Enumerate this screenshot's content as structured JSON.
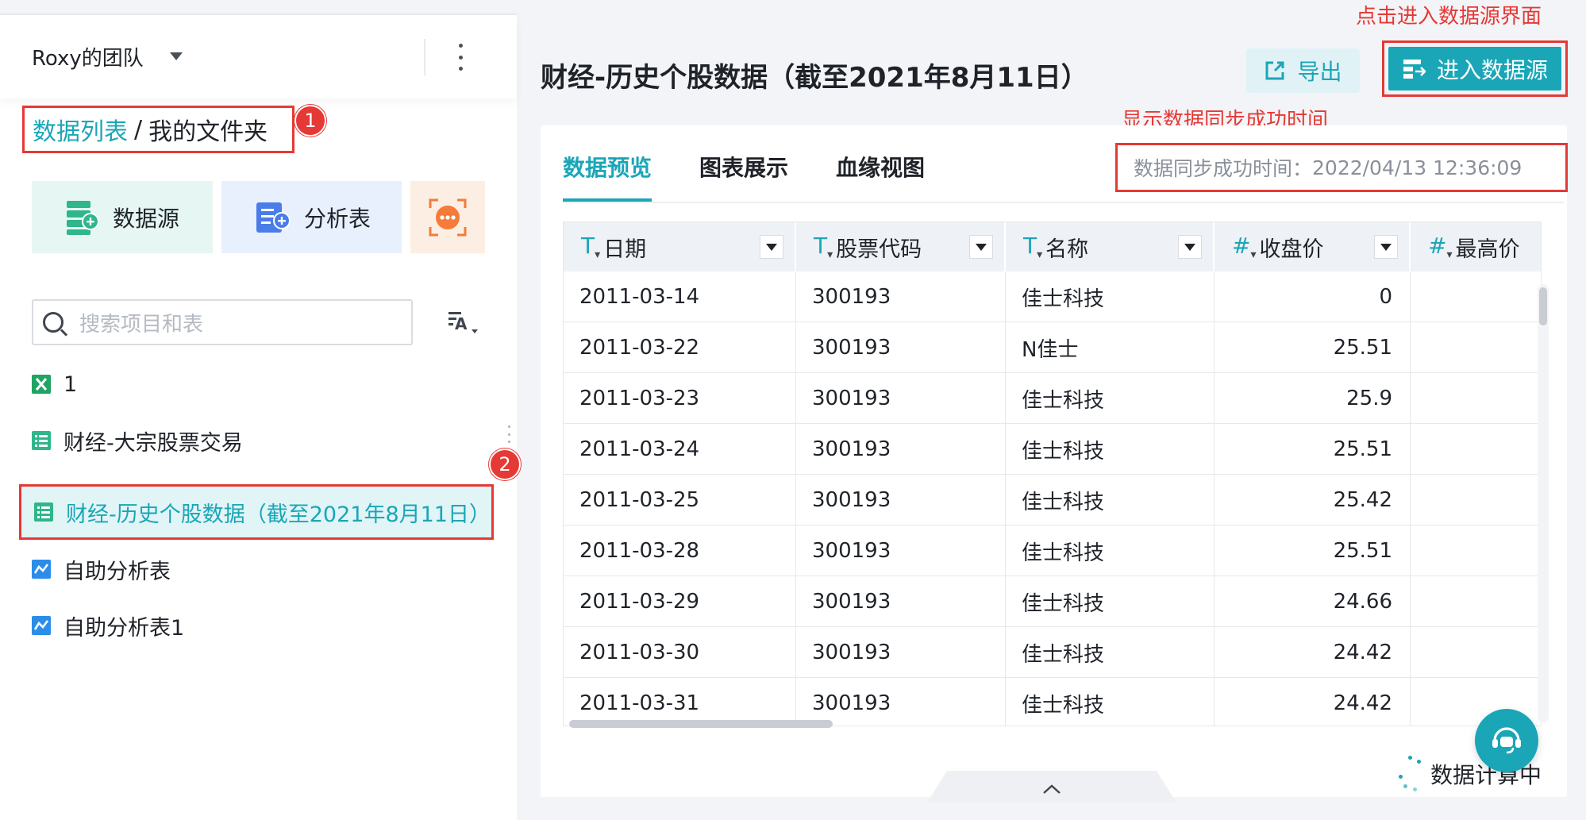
{
  "sidebar": {
    "team": "Roxy的团队",
    "breadcrumb": {
      "root": "数据列表",
      "separator": "/",
      "current": "我的文件夹"
    },
    "create_buttons": {
      "datasource": "数据源",
      "analysis": "分析表"
    },
    "search_placeholder": "搜索项目和表",
    "items": [
      {
        "label": "1",
        "icon": "excel-icon"
      },
      {
        "label": "财经-大宗股票交易",
        "icon": "table-icon"
      },
      {
        "label": "财经-历史个股数据（截至2021年8月11日）",
        "icon": "table-icon",
        "active": true
      },
      {
        "label": "自助分析表",
        "icon": "analysis-icon"
      },
      {
        "label": "自助分析表1",
        "icon": "analysis-icon"
      }
    ],
    "badges": [
      "1",
      "2"
    ]
  },
  "header": {
    "title": "财经-历史个股数据（截至2021年8月11日）",
    "export_label": "导出",
    "enter_label": "进入数据源"
  },
  "annotations": {
    "enter": "点击进入数据源界面",
    "sync": "显示数据同步成功时间"
  },
  "tabs": [
    "数据预览",
    "图表展示",
    "血缘视图"
  ],
  "sync": {
    "label": "数据同步成功时间：",
    "time": "2022/04/13 12:36:09"
  },
  "table": {
    "columns": [
      {
        "type": "T",
        "name": "日期"
      },
      {
        "type": "T",
        "name": "股票代码"
      },
      {
        "type": "T",
        "name": "名称"
      },
      {
        "type": "#",
        "name": "收盘价"
      },
      {
        "type": "#",
        "name": "最高价"
      }
    ],
    "rows": [
      [
        "2011-03-14",
        "300193",
        "佳士科技",
        "0",
        ""
      ],
      [
        "2011-03-22",
        "300193",
        "N佳士",
        "25.51",
        ""
      ],
      [
        "2011-03-23",
        "300193",
        "佳士科技",
        "25.9",
        ""
      ],
      [
        "2011-03-24",
        "300193",
        "佳士科技",
        "25.51",
        ""
      ],
      [
        "2011-03-25",
        "300193",
        "佳士科技",
        "25.42",
        ""
      ],
      [
        "2011-03-28",
        "300193",
        "佳士科技",
        "25.51",
        ""
      ],
      [
        "2011-03-29",
        "300193",
        "佳士科技",
        "24.66",
        ""
      ],
      [
        "2011-03-30",
        "300193",
        "佳士科技",
        "24.42",
        ""
      ],
      [
        "2011-03-31",
        "300193",
        "佳士科技",
        "24.42",
        ""
      ]
    ]
  },
  "status": {
    "computing": "数据计算中"
  },
  "colors": {
    "accent": "#1aa6b7",
    "annotation": "#e53935"
  }
}
